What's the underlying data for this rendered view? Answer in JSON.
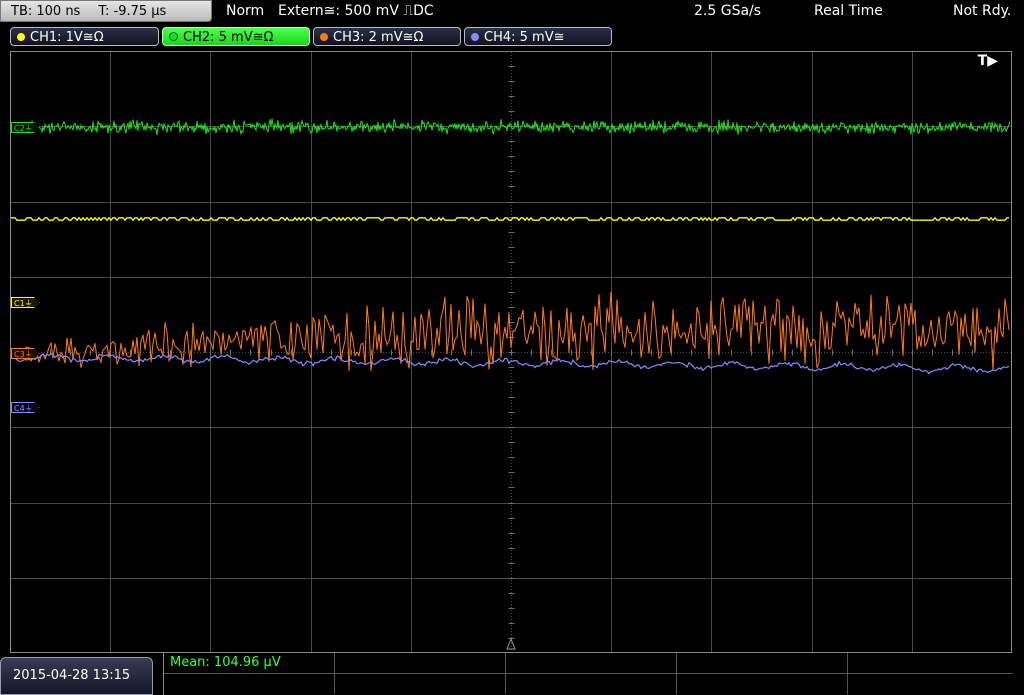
{
  "status": {
    "timebase": "TB: 100 ns",
    "trigger_time": "T: -9.75 µs",
    "trigger_mode": "Norm",
    "trigger_source": "Extern≅: 500 mV ⎍DC",
    "sample_rate": "2.5 GSa/s",
    "acquisition": "Real Time",
    "state": "Not Rdy."
  },
  "channels": [
    {
      "label": "CH1: 1V≅Ω",
      "color": "#ffff00",
      "active": false
    },
    {
      "label": "CH2: 5 mV≅Ω",
      "color": "#22dd22",
      "active": true
    },
    {
      "label": "CH3: 2 mV≅Ω",
      "color": "#ff7a1a",
      "active": false
    },
    {
      "label": "CH4: 5 mV≅",
      "color": "#8888ff",
      "active": false
    }
  ],
  "markers": {
    "trigger_indicator": "T▶",
    "ch1": "C1⏚",
    "ch2": "C2⏚",
    "ch3": "C3⏚",
    "ch4": "C4⏚"
  },
  "footer": {
    "datetime": "2015-04-28 13:15",
    "measurement": "Mean: 104.96 µV"
  },
  "colors": {
    "grid": "#4a4a4a",
    "ch1": "#ffff00",
    "ch2": "#22dd22",
    "ch3": "#ff7a1a",
    "ch4": "#8888ff",
    "measure": "#3cff3c"
  }
}
